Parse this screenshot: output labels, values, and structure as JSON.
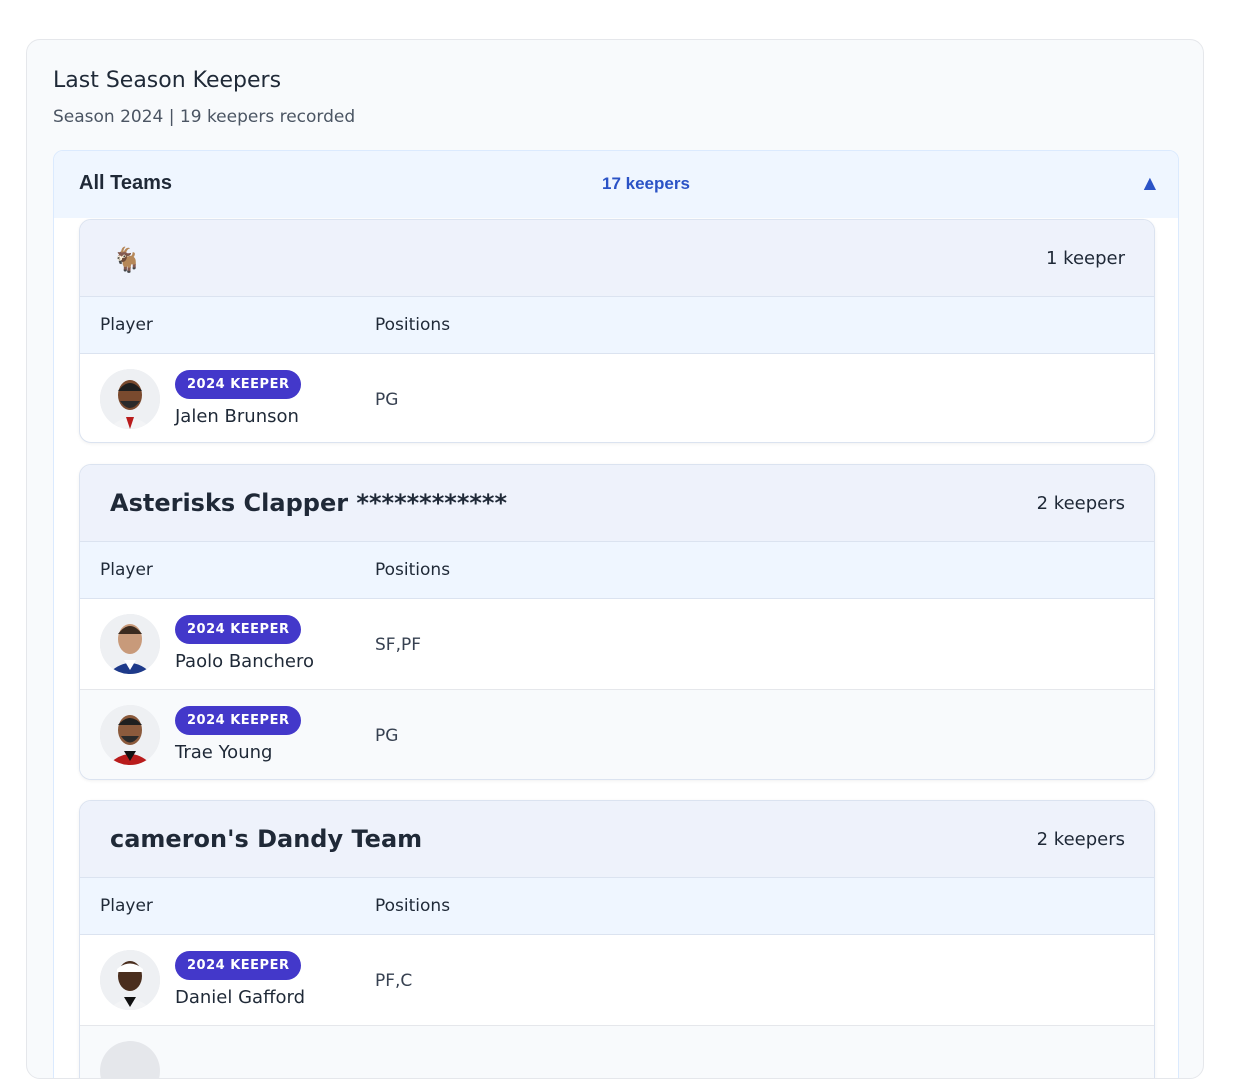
{
  "section": {
    "title": "Last Season Keepers",
    "subtitle": "Season 2024 | 19 keepers recorded"
  },
  "accordion": {
    "title": "All Teams",
    "count": "17 keepers",
    "toggle_icon": "▲"
  },
  "table_headers": {
    "player": "Player",
    "positions": "Positions"
  },
  "teams": [
    {
      "name": "",
      "icon": "goat-icon",
      "icon_glyph": "🐐",
      "count": "1 keeper",
      "players": [
        {
          "badge": "2024 KEEPER",
          "name": "Jalen Brunson",
          "positions": "PG"
        }
      ]
    },
    {
      "name": "Asterisks Clapper ************",
      "count": "2 keepers",
      "players": [
        {
          "badge": "2024 KEEPER",
          "name": "Paolo Banchero",
          "positions": "SF,PF"
        },
        {
          "badge": "2024 KEEPER",
          "name": "Trae Young",
          "positions": "PG"
        }
      ]
    },
    {
      "name": "cameron's Dandy Team",
      "count": "2 keepers",
      "players": [
        {
          "badge": "2024 KEEPER",
          "name": "Daniel Gafford",
          "positions": "PF,C"
        },
        {
          "badge": "",
          "name": "",
          "positions": ""
        }
      ]
    }
  ],
  "colors": {
    "accent": "#2b53c6",
    "badge": "#4338ca",
    "header_bg": "#eff6ff",
    "team_header_bg": "#eef2fb"
  }
}
